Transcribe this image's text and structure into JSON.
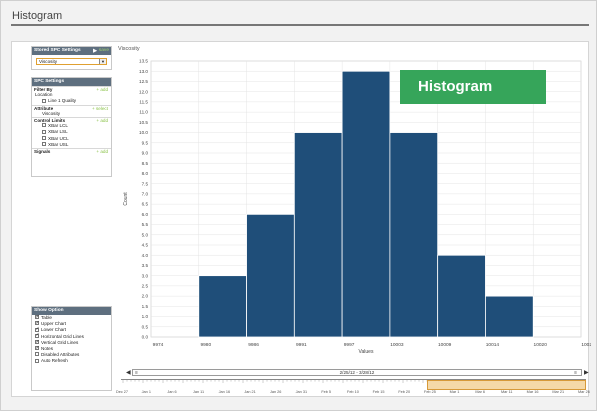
{
  "page": {
    "title": "Histogram"
  },
  "badge": {
    "label": "Histogram"
  },
  "stored_settings": {
    "header": "Stored SPC Settings",
    "save_label": "save",
    "selected": "Viscosity"
  },
  "spc_settings": {
    "header": "SPC Settings",
    "filter_by": {
      "label": "Filter By",
      "action": "+ add"
    },
    "location": {
      "label": "Location",
      "items": [
        "Line 1 Quality"
      ]
    },
    "attribute": {
      "label": "Attribute",
      "action": "+ select",
      "value": "Viscosity"
    },
    "control_limits": {
      "label": "Control Limits",
      "action": "+ add",
      "items": [
        "XBar LCL",
        "XBar LSL",
        "XBar UCL",
        "XBar USL"
      ]
    },
    "signals": {
      "label": "Signals",
      "action": "+ add"
    }
  },
  "show_option": {
    "header": "Show Option",
    "options": [
      {
        "label": "Table",
        "checked": true
      },
      {
        "label": "Upper Chart",
        "checked": true
      },
      {
        "label": "Lower Chart",
        "checked": true
      },
      {
        "label": "Horizontal Grid Lines",
        "checked": true
      },
      {
        "label": "Vertical Grid Lines",
        "checked": true
      },
      {
        "label": "Notes",
        "checked": true
      },
      {
        "label": "Disabled Attributes",
        "checked": false
      },
      {
        "label": "Auto Refresh",
        "checked": false
      }
    ]
  },
  "chart_data": {
    "type": "bar",
    "title": "Viscosity",
    "xlabel": "Values",
    "ylabel": "Count",
    "ylim": [
      0,
      13.5
    ],
    "yticks": [
      0,
      0.5,
      1,
      1.5,
      2,
      2.5,
      3,
      3.5,
      4,
      4.5,
      5,
      5.5,
      6,
      6.5,
      7,
      7.5,
      8,
      8.5,
      9,
      9.5,
      10,
      10.5,
      11,
      11.5,
      12,
      12.5,
      13,
      13.5
    ],
    "xticks": [
      "9974",
      "9980",
      "9986",
      "9991",
      "9997",
      "10003",
      "10009",
      "10014",
      "10020",
      "10026"
    ],
    "bins": [
      {
        "from": "9974",
        "to": "9980",
        "value": 0
      },
      {
        "from": "9980",
        "to": "9986",
        "value": 3
      },
      {
        "from": "9986",
        "to": "9991",
        "value": 6
      },
      {
        "from": "9991",
        "to": "9997",
        "value": 10
      },
      {
        "from": "9997",
        "to": "10003",
        "value": 13
      },
      {
        "from": "10003",
        "to": "10009",
        "value": 10
      },
      {
        "from": "10009",
        "to": "10014",
        "value": 4
      },
      {
        "from": "10014",
        "to": "10020",
        "value": 2
      },
      {
        "from": "10020",
        "to": "10026",
        "value": 0
      }
    ],
    "bar_color": "#1f4e79",
    "grid": true
  },
  "range": {
    "label": "2/25/12 - 3/28/12"
  },
  "timeline": {
    "labels": [
      "Dec 27",
      "Jan 1",
      "Jan 6",
      "Jan 11",
      "Jan 16",
      "Jan 21",
      "Jan 26",
      "Jan 31",
      "Feb 5",
      "Feb 10",
      "Feb 15",
      "Feb 20",
      "Feb 25",
      "Mar 1",
      "Mar 6",
      "Mar 11",
      "Mar 16",
      "Mar 21",
      "Mar 26"
    ]
  }
}
